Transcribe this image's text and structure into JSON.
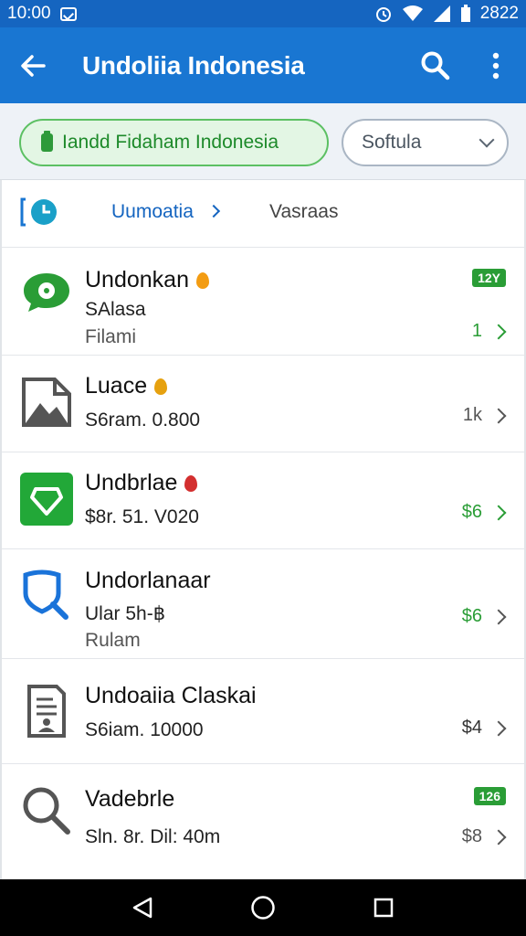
{
  "status_bar": {
    "time": "10:00",
    "right_text": "2822"
  },
  "app_bar": {
    "title": "Undoliia Indonesia"
  },
  "filters": {
    "chip_label": "Iandd Fidaham Indonesia",
    "select_value": "Softula"
  },
  "breadcrumb": {
    "link": "Uumoatia",
    "secondary": "Vasraas"
  },
  "items": [
    {
      "title": "Undonkan",
      "sub": "SAlasa",
      "sub2": "Filami",
      "badge": "12Y",
      "trail": "1",
      "trail_color": "#2a9d36",
      "icon": "chat-bubble-icon",
      "title_icon": "flame-icon",
      "accent": "#2a9d36"
    },
    {
      "title": "Luace",
      "sub": "S6ram. 0.800",
      "sub2": "",
      "badge": "",
      "trail": "1k",
      "trail_color": "#555555",
      "icon": "image-file-icon",
      "title_icon": "flame-icon",
      "accent": "#555555"
    },
    {
      "title": "Undbrlae",
      "sub": "$8r. 51. V020",
      "sub2": "",
      "badge": "",
      "trail": "$6",
      "trail_color": "#2a9d36",
      "icon": "tag-icon",
      "title_icon": "drop-icon",
      "accent": "#2a9d36"
    },
    {
      "title": "Undorlanaar",
      "sub": "Ular 5h-฿",
      "sub2": "Rulam",
      "badge": "",
      "trail": "$6",
      "trail_color": "#2a9d36",
      "icon": "magnify-icon",
      "title_icon": "",
      "accent": "#2a9d36"
    },
    {
      "title": "Undoaiia Claskai",
      "sub": "S6iam. 10000",
      "sub2": "",
      "badge": "",
      "trail": "$4",
      "trail_color": "#333333",
      "icon": "document-icon",
      "title_icon": "",
      "accent": "#555555"
    },
    {
      "title": "Vadebrle",
      "sub": "Sln. 8r. Dil: 40m",
      "sub2": "",
      "badge": "126",
      "trail": "$8",
      "trail_color": "#555555",
      "icon": "search-icon",
      "title_icon": "",
      "accent": "#555555"
    }
  ]
}
